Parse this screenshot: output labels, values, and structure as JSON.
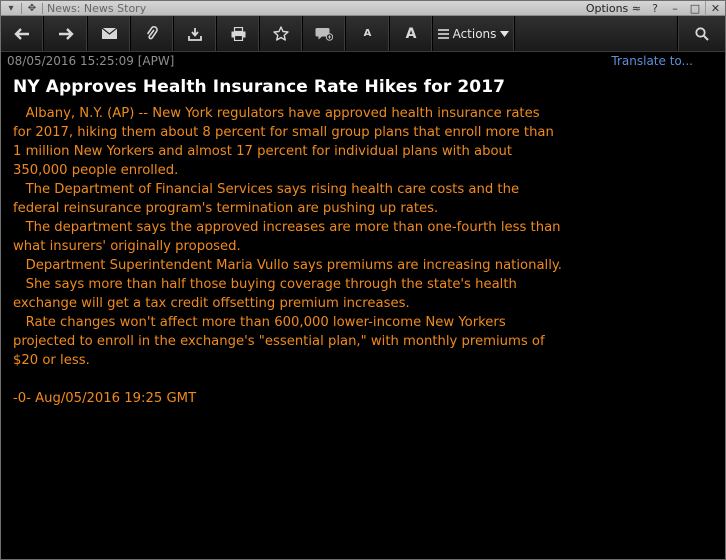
{
  "window": {
    "title": "News: News Story",
    "options_label": "Options",
    "help": "?"
  },
  "toolbar": {
    "font_small": "A",
    "font_large": "A",
    "actions_label": "Actions"
  },
  "story": {
    "timestamp": "08/05/2016 15:25:09 [APW]",
    "translate_link": "Translate to...",
    "headline": "NY Approves Health Insurance Rate Hikes for 2017",
    "lines": [
      "   Albany, N.Y. (AP) -- New York regulators have approved health insurance rates",
      "for 2017, hiking them about 8 percent for small group plans that enroll more than",
      "1 million New Yorkers and almost 17 percent for individual plans with about",
      "350,000 people enrolled.",
      "   The Department of Financial Services says rising health care costs and the",
      "federal reinsurance program's termination are pushing up rates.",
      "   The department says the approved increases are more than one-fourth less than",
      "what insurers' originally proposed.",
      "   Department Superintendent Maria Vullo says premiums are increasing nationally.",
      "   She says more than half those buying coverage through the state's health",
      "exchange will get a tax credit offsetting premium increases.",
      "   Rate changes won't affect more than 600,000 lower-income New Yorkers",
      "projected to enroll in the exchange's \"essential plan,\" with monthly premiums of",
      "$20 or less."
    ],
    "footer": "-0- Aug/05/2016 19:25 GMT"
  }
}
